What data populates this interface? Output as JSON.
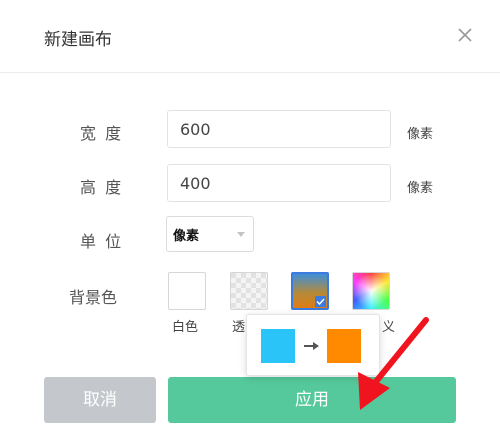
{
  "dialog": {
    "title": "新建画布",
    "close_icon": "close-icon"
  },
  "form": {
    "width": {
      "label": "宽 度",
      "value": "600",
      "unit": "像素"
    },
    "height": {
      "label": "高 度",
      "value": "400",
      "unit": "像素"
    },
    "unit": {
      "label": "单 位",
      "selected": "像素"
    },
    "background": {
      "label": "背景色",
      "options": [
        {
          "label": "白色",
          "color": "#ffffff"
        },
        {
          "label": "透",
          "style": "transparent"
        },
        {
          "label": "",
          "style": "gradient",
          "selected": true
        },
        {
          "label": "义",
          "style": "custom"
        }
      ],
      "gradient_popover": {
        "from_color": "#2bc4f9",
        "to_color": "#ff8a00"
      }
    }
  },
  "buttons": {
    "cancel_label": "取消",
    "apply_label": "应用"
  },
  "colors": {
    "apply": "#55c99b",
    "cancel": "#c4c8cd",
    "selected_border": "#3b7be0",
    "annotation_arrow": "#f0141e"
  }
}
